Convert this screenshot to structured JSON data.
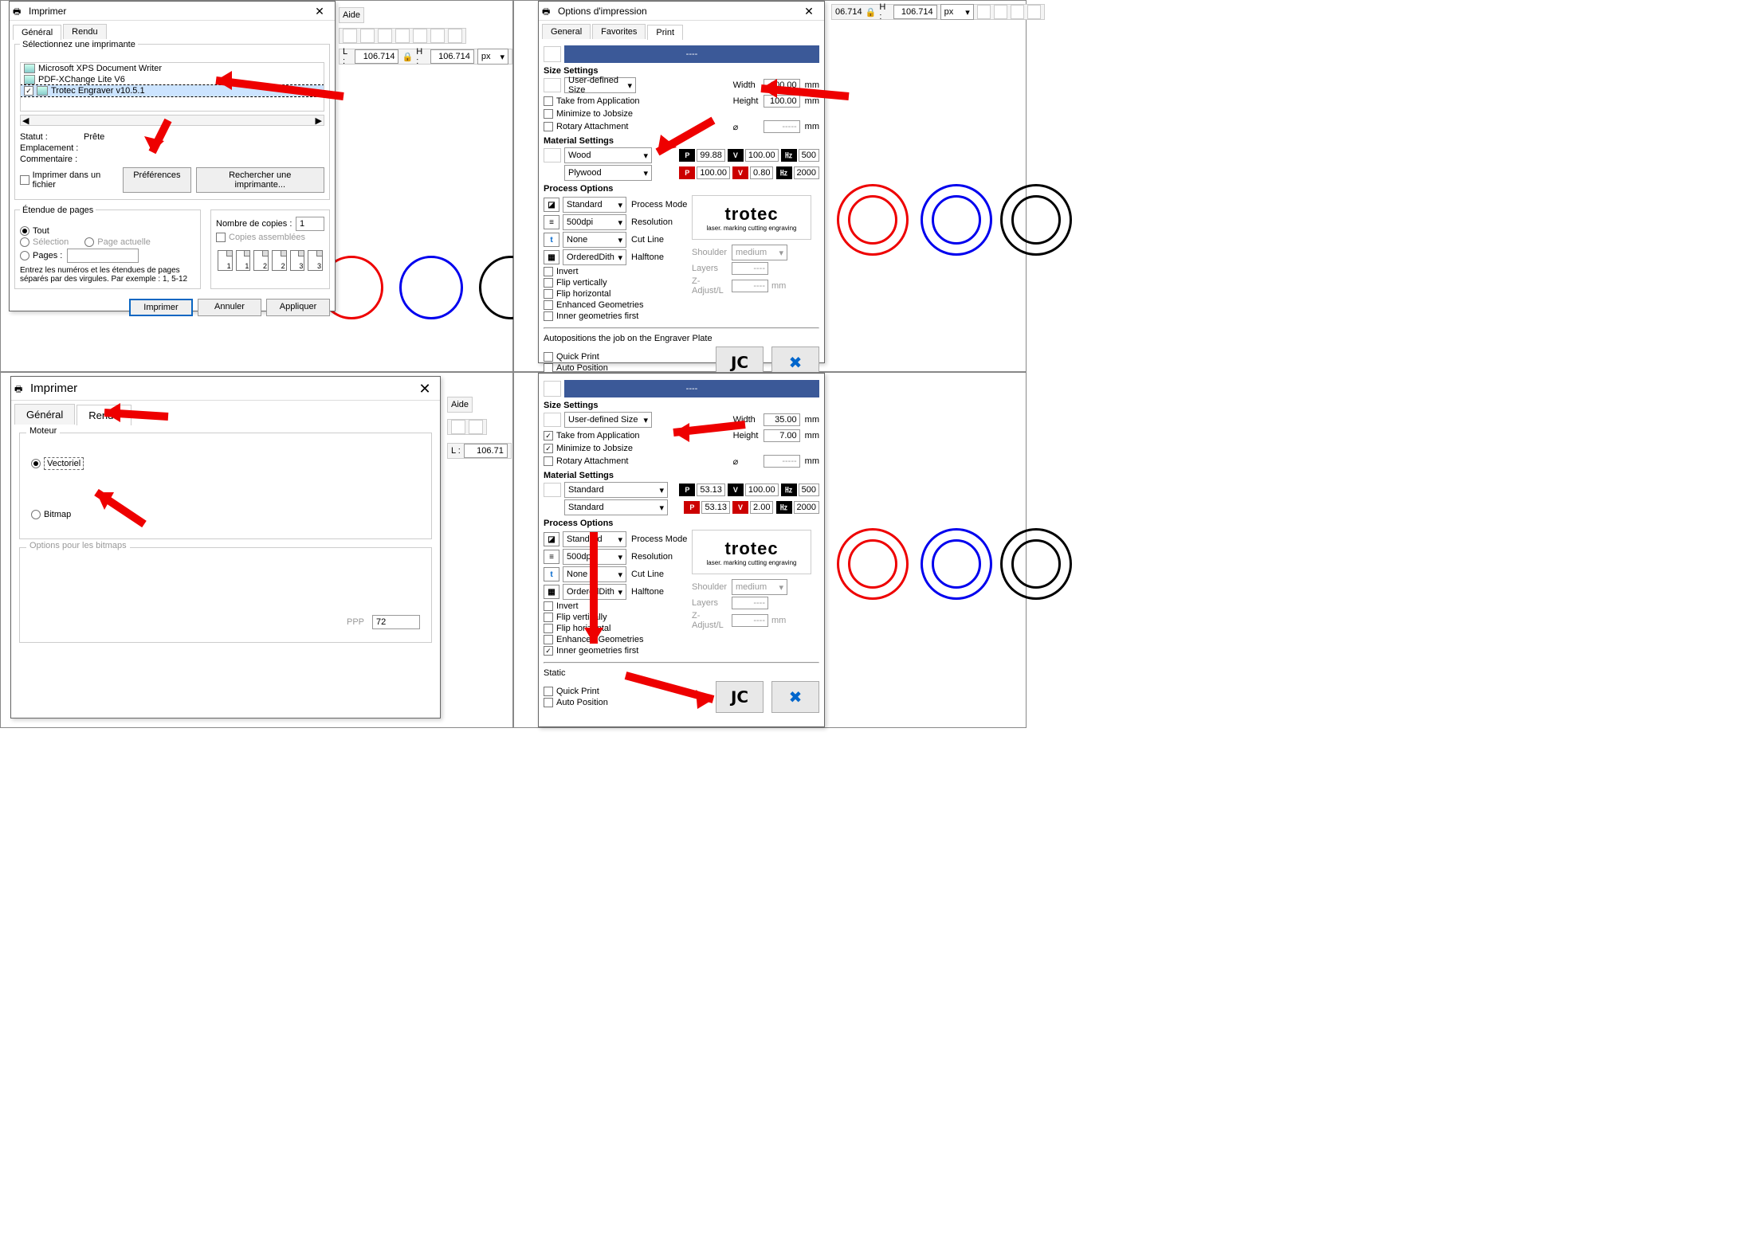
{
  "q1": {
    "title": "Imprimer",
    "tabs": {
      "general": "Général",
      "rendu": "Rendu"
    },
    "select_printer": "Sélectionnez une imprimante",
    "printers": [
      {
        "name": "Microsoft XPS Document Writer"
      },
      {
        "name": "PDF-XChange Lite V6"
      },
      {
        "name": "Trotec Engraver v10.5.1",
        "selected": true
      }
    ],
    "status_lbl": "Statut :",
    "status_val": "Prête",
    "location_lbl": "Emplacement :",
    "comment_lbl": "Commentaire :",
    "print_to_file": "Imprimer dans un fichier",
    "prefs": "Préférences",
    "find_printer": "Rechercher une imprimante...",
    "page_range": "Étendue de pages",
    "all": "Tout",
    "selection": "Sélection",
    "current": "Page actuelle",
    "pages": "Pages :",
    "pages_hint": "Entrez les numéros et les étendues de pages séparés par des virgules. Par exemple : 1, 5-12",
    "copies": "Nombre de copies :",
    "copies_val": "1",
    "collate": "Copies assemblées",
    "pageicons": [
      "1",
      "2",
      "3"
    ],
    "btn_print": "Imprimer",
    "btn_cancel": "Annuler",
    "btn_apply": "Appliquer",
    "aide": "Aide"
  },
  "q2": {
    "title": "Options d'impression",
    "tabs": {
      "general": "General",
      "favorites": "Favorites",
      "print": "Print"
    },
    "dash": "----",
    "size_settings": "Size Settings",
    "size_select": "User-defined Size",
    "width": "Width",
    "width_val": "100.00",
    "height": "Height",
    "height_val": "100.00",
    "mm": "mm",
    "take_from_app": "Take from Application",
    "min_job": "Minimize to Jobsize",
    "rotary": "Rotary Attachment",
    "blank": "-----",
    "material": "Material Settings",
    "mat_top": "Wood",
    "mat_sub": "Plywood",
    "m1p": "99.88",
    "m1v": "100.00",
    "m1h": "500",
    "m2p": "100.00",
    "m2v": "0.80",
    "m2h": "2000",
    "process": "Process Options",
    "proc_mode": "Process Mode",
    "proc_mode_val": "Standard",
    "resolution": "Resolution",
    "resolution_val": "500dpi",
    "cutline": "Cut Line",
    "cutline_val": "None",
    "halftone": "Halftone",
    "halftone_val": "OrderedDith",
    "invert": "Invert",
    "flipv": "Flip vertically",
    "fliph": "Flip horizontal",
    "enh": "Enhanced Geometries",
    "inner": "Inner geometries first",
    "shoulder": "Shoulder",
    "shoulder_val": "medium",
    "layers": "Layers",
    "layers_val": "----",
    "zadj": "Z-Adjust/L",
    "zadj_val": "----",
    "autopos": "Autopositions the job on the Engraver Plate",
    "quick": "Quick Print",
    "auto": "Auto Position",
    "logo_t": "trotec",
    "logo_s": "laser. marking cutting engraving",
    "bg": {
      "L": "L :",
      "H": "H :",
      "val": "106.714",
      "px": "px"
    },
    "header_row": {
      "val": "06.714",
      "H": "H :",
      "val2": "106.714",
      "px": "px"
    }
  },
  "q3": {
    "title": "Imprimer",
    "tabs": {
      "general": "Général",
      "rendu": "Rendu"
    },
    "moteur": "Moteur",
    "vect": "Vectoriel",
    "bitmap": "Bitmap",
    "bmpopts": "Options pour les bitmaps",
    "ppp": "PPP",
    "ppp_val": "72",
    "aide": "Aide",
    "L": "L :",
    "Lval": "106.71"
  },
  "q4": {
    "dash": "----",
    "size_settings": "Size Settings",
    "size_select": "User-defined Size",
    "width": "Width",
    "width_val": "35.00",
    "height": "Height",
    "height_val": "7.00",
    "mm": "mm",
    "take_from_app": "Take from Application",
    "min_job": "Minimize to Jobsize",
    "rotary": "Rotary Attachment",
    "blank": "-----",
    "material": "Material Settings",
    "mat_top": "Standard",
    "mat_sub": "Standard",
    "m1p": "53.13",
    "m1v": "100.00",
    "m1h": "500",
    "m2p": "53.13",
    "m2v": "2.00",
    "m2h": "2000",
    "process": "Process Options",
    "proc_mode": "Process Mode",
    "proc_mode_val": "Standard",
    "resolution": "Resolution",
    "resolution_val": "500dpi",
    "cutline": "Cut Line",
    "cutline_val": "None",
    "halftone": "Halftone",
    "halftone_val": "OrderedDith",
    "invert": "Invert",
    "flipv": "Flip vertically",
    "fliph": "Flip horizontal",
    "enh": "Enhanced Geometries",
    "inner": "Inner geometries first",
    "shoulder": "Shoulder",
    "shoulder_val": "medium",
    "layers": "Layers",
    "layers_val": "----",
    "zadj": "Z-Adjust/L",
    "zadj_val": "----",
    "static": "Static",
    "quick": "Quick Print",
    "auto": "Auto Position",
    "logo_t": "trotec",
    "logo_s": "laser. marking cutting engraving"
  }
}
